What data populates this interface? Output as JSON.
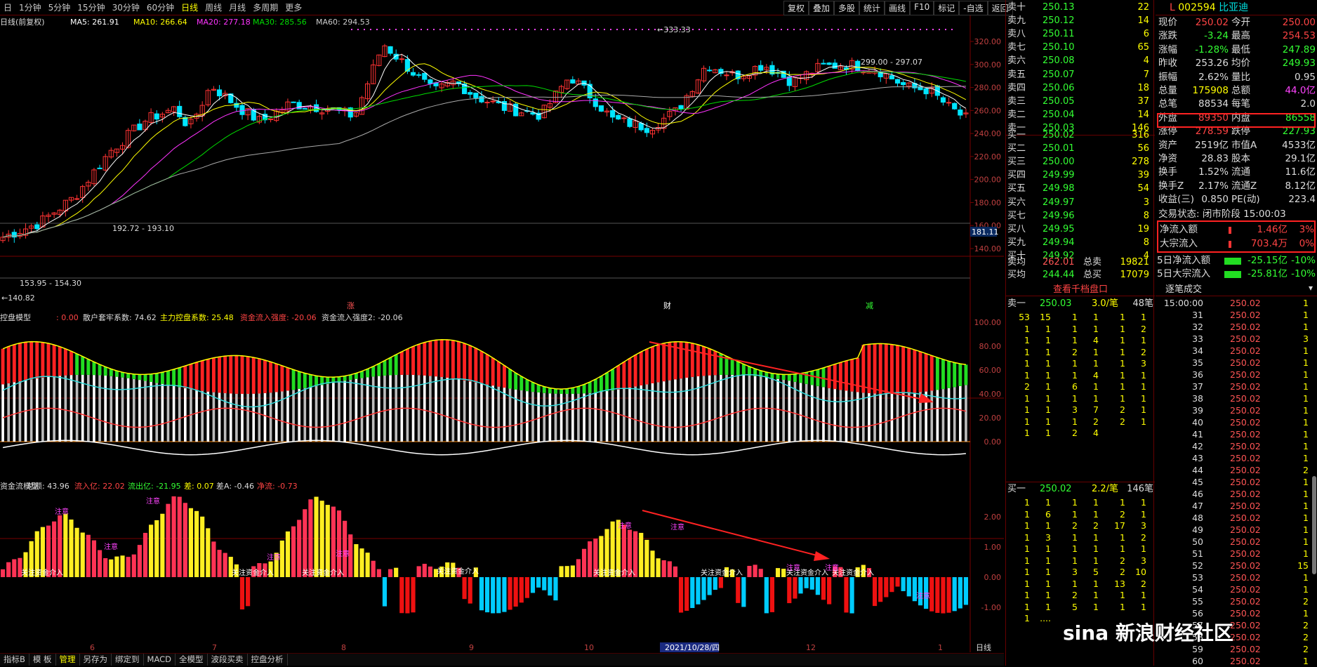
{
  "tabs": [
    "日",
    "1分钟",
    "5分钟",
    "15分钟",
    "30分钟",
    "60分钟",
    "日线",
    "周线",
    "月线",
    "多周期",
    "更多"
  ],
  "active_tab": "日线",
  "tools": [
    "复权",
    "叠加",
    "多股",
    "统计",
    "画线",
    "F10",
    "标记",
    "-自选",
    "返回"
  ],
  "main_legend": {
    "name": "日线(前复权)",
    "ma5": "MA5: 261.91",
    "ma10": "MA10: 266.64",
    "ma20": "MA20: 277.18",
    "ma30": "MA30: 285.56",
    "ma60": "MA60: 294.53"
  },
  "price_axis": [
    "320.00",
    "300.00",
    "280.00",
    "260.00",
    "240.00",
    "220.00",
    "200.00",
    "180.00",
    "160.00",
    "140.00"
  ],
  "price_labels": {
    "high": "333.33",
    "mid": "299.00 - 297.07",
    "low": "192.72 - 193.10",
    "low2": "153.95 - 154.30",
    "min": "140.82",
    "current": "181.11"
  },
  "event_labels": [
    "涨",
    "财",
    "减"
  ],
  "ind1_legend": {
    "name": "控盘模型",
    "v0": ": 0.00",
    "a": "散户套牢系数: 74.62",
    "b": "主力控盘系数: 25.48",
    "c": "资金流入强度: -20.06",
    "d": "资金流入强度2: -20.06"
  },
  "ind1_axis": [
    "100.00",
    "80.00",
    "60.00",
    "40.00",
    "20.00",
    "0.00"
  ],
  "ind2_legend": {
    "name": "资金流模型",
    "total": "总额: 43.96",
    "in": "流入亿: 22.02",
    "out": "流出亿: -21.95",
    "diff": "差: 0.07",
    "diffA": "差A: -0.46",
    "net": "净流: -0.73"
  },
  "ind2_axis": [
    "2.00",
    "1.00",
    "0.00",
    "-1.00"
  ],
  "ind2_annot": [
    "关注资金介入",
    "注意"
  ],
  "x_axis": [
    "6",
    "7",
    "8",
    "9",
    "10",
    "2021/10/28/四",
    "12",
    "1"
  ],
  "x_axis_right": "日线",
  "bottom_tabs": [
    "指标B",
    "模 板",
    "管理",
    "另存为",
    "绑定到",
    "MACD",
    "全模型",
    "波段买卖",
    "控盘分析"
  ],
  "bottom_active": "管理",
  "asks": [
    {
      "l": "卖十",
      "p": "250.13",
      "v": "22"
    },
    {
      "l": "卖九",
      "p": "250.12",
      "v": "14"
    },
    {
      "l": "卖八",
      "p": "250.11",
      "v": "6"
    },
    {
      "l": "卖七",
      "p": "250.10",
      "v": "65"
    },
    {
      "l": "卖六",
      "p": "250.08",
      "v": "4"
    },
    {
      "l": "卖五",
      "p": "250.07",
      "v": "7"
    },
    {
      "l": "卖四",
      "p": "250.06",
      "v": "18"
    },
    {
      "l": "卖三",
      "p": "250.05",
      "v": "37"
    },
    {
      "l": "卖二",
      "p": "250.04",
      "v": "14"
    },
    {
      "l": "卖一",
      "p": "250.03",
      "v": "146"
    }
  ],
  "bids": [
    {
      "l": "买一",
      "p": "250.02",
      "v": "316"
    },
    {
      "l": "买二",
      "p": "250.01",
      "v": "56"
    },
    {
      "l": "买三",
      "p": "250.00",
      "v": "278"
    },
    {
      "l": "买四",
      "p": "249.99",
      "v": "39"
    },
    {
      "l": "买五",
      "p": "249.98",
      "v": "54"
    },
    {
      "l": "买六",
      "p": "249.97",
      "v": "3"
    },
    {
      "l": "买七",
      "p": "249.96",
      "v": "8"
    },
    {
      "l": "买八",
      "p": "249.95",
      "v": "19"
    },
    {
      "l": "买九",
      "p": "249.94",
      "v": "8"
    },
    {
      "l": "买十",
      "p": "249.92",
      "v": "4"
    }
  ],
  "avg": {
    "sell_l": "卖均",
    "sell_p": "262.01",
    "sell_tl": "总卖",
    "sell_t": "19821",
    "buy_l": "买均",
    "buy_p": "244.44",
    "buy_tl": "总买",
    "buy_t": "17079"
  },
  "view_1000": "查看千档盘口",
  "sell1": {
    "l": "卖一",
    "p": "250.03",
    "v": "3.0/笔",
    "n": "48笔"
  },
  "sell1_grid": [
    [
      "53",
      "15",
      "1",
      "1",
      "1",
      "1"
    ],
    [
      "1",
      "1",
      "1",
      "1",
      "1",
      "2"
    ],
    [
      "1",
      "1",
      "1",
      "4",
      "1",
      "1"
    ],
    [
      "1",
      "1",
      "2",
      "1",
      "1",
      "2"
    ],
    [
      "1",
      "1",
      "1",
      "1",
      "1",
      "3"
    ],
    [
      "1",
      "1",
      "1",
      "4",
      "1",
      "1"
    ],
    [
      "2",
      "1",
      "6",
      "1",
      "1",
      "1"
    ],
    [
      "1",
      "1",
      "1",
      "1",
      "1",
      "1"
    ],
    [
      "1",
      "1",
      "3",
      "7",
      "2",
      "1"
    ],
    [
      "1",
      "1",
      "1",
      "2",
      "2",
      "1"
    ],
    [
      "1",
      "1",
      "2",
      "4",
      "",
      ""
    ]
  ],
  "buy1": {
    "l": "买一",
    "p": "250.02",
    "v": "2.2/笔",
    "n": "146笔"
  },
  "buy1_grid": [
    [
      "1",
      "1",
      "1",
      "1",
      "1",
      "1"
    ],
    [
      "1",
      "6",
      "1",
      "1",
      "2",
      "1"
    ],
    [
      "1",
      "1",
      "2",
      "2",
      "17",
      "3"
    ],
    [
      "1",
      "3",
      "1",
      "1",
      "1",
      "2"
    ],
    [
      "1",
      "1",
      "1",
      "1",
      "1",
      "1"
    ],
    [
      "1",
      "1",
      "1",
      "1",
      "2",
      "3"
    ],
    [
      "1",
      "1",
      "3",
      "5",
      "2",
      "10"
    ],
    [
      "1",
      "1",
      "1",
      "1",
      "13",
      "2"
    ],
    [
      "1",
      "1",
      "2",
      "1",
      "1",
      "1"
    ],
    [
      "1",
      "1",
      "5",
      "1",
      "1",
      "1"
    ],
    [
      "1",
      "....",
      "",
      "",
      "",
      ""
    ]
  ],
  "stock": {
    "code": "002594",
    "name": "比亚迪",
    "prefix": "L"
  },
  "quote": [
    {
      "a": "现价",
      "av": "250.02",
      "ac": "red",
      "b": "今开",
      "bv": "250.00",
      "bc": "red"
    },
    {
      "a": "涨跌",
      "av": "-3.24",
      "ac": "grn",
      "b": "最高",
      "bv": "254.53",
      "bc": "red"
    },
    {
      "a": "涨幅",
      "av": "-1.28%",
      "ac": "grn",
      "b": "最低",
      "bv": "247.89",
      "bc": "grn"
    },
    {
      "a": "昨收",
      "av": "253.26",
      "ac": "wht",
      "b": "均价",
      "bv": "249.93",
      "bc": "grn"
    },
    {
      "a": "振幅",
      "av": "2.62%",
      "ac": "wht",
      "b": "量比",
      "bv": "0.95",
      "bc": "wht"
    },
    {
      "a": "总量",
      "av": "175908",
      "ac": "yel",
      "b": "总额",
      "bv": "44.0亿",
      "bc": "mag"
    },
    {
      "a": "总笔",
      "av": "88534",
      "ac": "wht",
      "b": "每笔",
      "bv": "2.0",
      "bc": "wht"
    },
    {
      "a": "外盘",
      "av": "89350",
      "ac": "red",
      "b": "内盘",
      "bv": "86558",
      "bc": "grn"
    },
    {
      "a": "涨停",
      "av": "278.59",
      "ac": "red",
      "b": "跌停",
      "bv": "227.93",
      "bc": "grn"
    },
    {
      "a": "资产",
      "av": "2519亿",
      "ac": "wht",
      "b": "市值A",
      "bv": "4533亿",
      "bc": "wht"
    },
    {
      "a": "净资",
      "av": "28.83",
      "ac": "wht",
      "b": "股本",
      "bv": "29.1亿",
      "bc": "wht"
    },
    {
      "a": "换手",
      "av": "1.52%",
      "ac": "wht",
      "b": "流通",
      "bv": "11.6亿",
      "bc": "wht"
    },
    {
      "a": "换手Z",
      "av": "2.17%",
      "ac": "wht",
      "b": "流通Z",
      "bv": "8.12亿",
      "bc": "wht"
    },
    {
      "a": "收益(三)",
      "av": "0.850",
      "ac": "wht",
      "b": "PE(动)",
      "bv": "223.4",
      "bc": "wht"
    }
  ],
  "trade_state": "交易状态: 闭市阶段 15:00:03",
  "flow": [
    {
      "l": "净流入额",
      "v": "1.46亿",
      "p": "3%"
    },
    {
      "l": "大宗流入",
      "v": "703.4万",
      "p": "0%"
    }
  ],
  "flow5": [
    {
      "l": "5日净流入额",
      "v": "-25.15亿",
      "p": "-10%"
    },
    {
      "l": "5日大宗流入",
      "v": "-25.81亿",
      "p": "-10%"
    }
  ],
  "ticks_title": "逐笔成交",
  "ticks": [
    {
      "t": "15:00:00",
      "p": "250.02",
      "n": "1"
    },
    {
      "t": "31",
      "p": "250.02",
      "n": "1"
    },
    {
      "t": "32",
      "p": "250.02",
      "n": "1"
    },
    {
      "t": "33",
      "p": "250.02",
      "n": "3"
    },
    {
      "t": "34",
      "p": "250.02",
      "n": "1"
    },
    {
      "t": "35",
      "p": "250.02",
      "n": "1"
    },
    {
      "t": "36",
      "p": "250.02",
      "n": "1"
    },
    {
      "t": "37",
      "p": "250.02",
      "n": "1"
    },
    {
      "t": "38",
      "p": "250.02",
      "n": "1"
    },
    {
      "t": "39",
      "p": "250.02",
      "n": "1"
    },
    {
      "t": "40",
      "p": "250.02",
      "n": "1"
    },
    {
      "t": "41",
      "p": "250.02",
      "n": "1"
    },
    {
      "t": "42",
      "p": "250.02",
      "n": "1"
    },
    {
      "t": "43",
      "p": "250.02",
      "n": "1"
    },
    {
      "t": "44",
      "p": "250.02",
      "n": "2"
    },
    {
      "t": "45",
      "p": "250.02",
      "n": "1"
    },
    {
      "t": "46",
      "p": "250.02",
      "n": "1"
    },
    {
      "t": "47",
      "p": "250.02",
      "n": "1"
    },
    {
      "t": "48",
      "p": "250.02",
      "n": "1"
    },
    {
      "t": "49",
      "p": "250.02",
      "n": "1"
    },
    {
      "t": "50",
      "p": "250.02",
      "n": "1"
    },
    {
      "t": "51",
      "p": "250.02",
      "n": "1"
    },
    {
      "t": "52",
      "p": "250.02",
      "n": "15"
    },
    {
      "t": "53",
      "p": "250.02",
      "n": "1"
    },
    {
      "t": "54",
      "p": "250.02",
      "n": "1"
    },
    {
      "t": "55",
      "p": "250.02",
      "n": "2"
    },
    {
      "t": "56",
      "p": "250.02",
      "n": "1"
    },
    {
      "t": "57",
      "p": "250.02",
      "n": "2"
    },
    {
      "t": "58",
      "p": "250.02",
      "n": "2"
    },
    {
      "t": "59",
      "p": "250.02",
      "n": "2"
    },
    {
      "t": "60",
      "p": "250.02",
      "n": "1"
    }
  ],
  "watermark": "sina 新浪财经社区",
  "colors": {
    "up": "#ff3333",
    "down": "#00e5ff",
    "ma5": "#ffffff",
    "ma10": "#ffff00",
    "ma20": "#ff33ff",
    "ma30": "#00dd00",
    "ma60": "#aaaaaa"
  }
}
